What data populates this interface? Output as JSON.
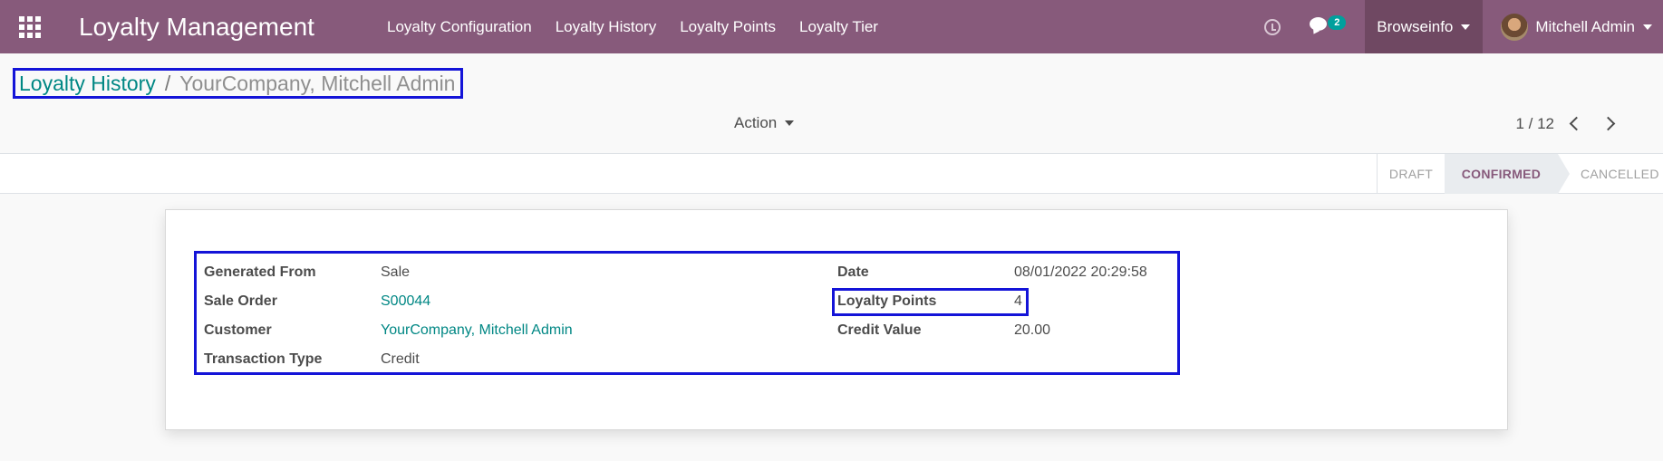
{
  "navbar": {
    "title": "Loyalty Management",
    "menu": [
      "Loyalty Configuration",
      "Loyalty History",
      "Loyalty Points",
      "Loyalty Tier"
    ],
    "messages_count": "2",
    "company": "Browseinfo",
    "user": "Mitchell Admin",
    "bg_color": "#875a7b"
  },
  "breadcrumb": {
    "parent": "Loyalty History",
    "separator": "/",
    "current": "YourCompany, Mitchell Admin"
  },
  "toolbar": {
    "action_label": "Action",
    "pager": "1 / 12"
  },
  "statusbar": {
    "states": [
      "DRAFT",
      "CONFIRMED",
      "CANCELLED"
    ],
    "active": "CONFIRMED"
  },
  "form": {
    "left": [
      {
        "label": "Generated From",
        "value": "Sale"
      },
      {
        "label": "Sale Order",
        "value": "S00044"
      },
      {
        "label": "Customer",
        "value": "YourCompany, Mitchell Admin"
      },
      {
        "label": "Transaction Type",
        "value": "Credit"
      }
    ],
    "right": [
      {
        "label": "Date",
        "value": "08/01/2022 20:29:58"
      },
      {
        "label": "Loyalty Points",
        "value": "4"
      },
      {
        "label": "Credit Value",
        "value": "20.00"
      }
    ]
  }
}
